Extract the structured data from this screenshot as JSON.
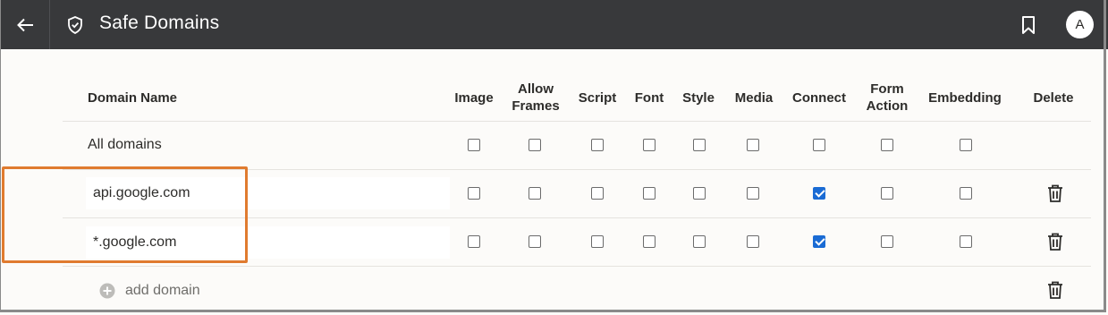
{
  "header": {
    "title": "Safe Domains",
    "avatar_initial": "A"
  },
  "columns": {
    "domain_name": "Domain Name",
    "image": "Image",
    "allow_frames_1": "Allow",
    "allow_frames_2": "Frames",
    "script": "Script",
    "font": "Font",
    "style": "Style",
    "media": "Media",
    "connect": "Connect",
    "form_action_1": "Form",
    "form_action_2": "Action",
    "embedding": "Embedding",
    "delete": "Delete"
  },
  "rows": [
    {
      "domain": "All domains",
      "editable": false,
      "checks": [
        false,
        false,
        false,
        false,
        false,
        false,
        false,
        false,
        false
      ]
    },
    {
      "domain": "api.google.com",
      "editable": true,
      "checks": [
        false,
        false,
        false,
        false,
        false,
        false,
        true,
        false,
        false
      ]
    },
    {
      "domain": "*.google.com",
      "editable": true,
      "checks": [
        false,
        false,
        false,
        false,
        false,
        false,
        true,
        false,
        false
      ]
    }
  ],
  "add_domain_label": "add domain",
  "colors": {
    "topbar": "#38393b",
    "checked": "#1a6bd4",
    "highlight": "#e07b2f"
  }
}
